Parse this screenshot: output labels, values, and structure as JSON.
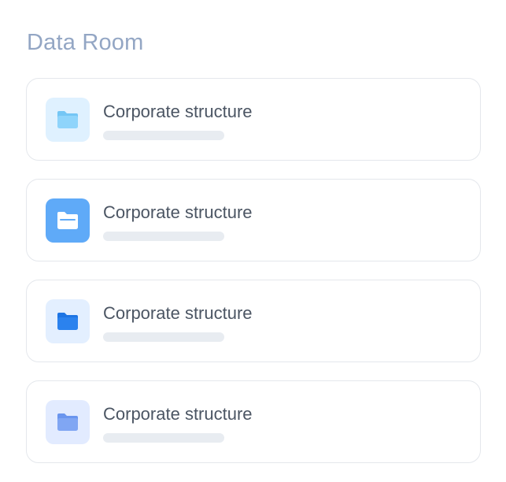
{
  "section": {
    "title": "Data Room"
  },
  "folders": [
    {
      "title": "Corporate structure",
      "icon": "folder-icon",
      "tile_color": "#dff1ff",
      "back_color": "#74c6f5",
      "front_color": "#8fd4fb",
      "detail_color": "#8fd4fb"
    },
    {
      "title": "Corporate structure",
      "icon": "folder-icon",
      "tile_color": "#5faaf8",
      "back_color": "#ffffff",
      "front_color": "#ffffff",
      "detail_color": "#5faaf8"
    },
    {
      "title": "Corporate structure",
      "icon": "folder-icon",
      "tile_color": "#e3efff",
      "back_color": "#1e75e4",
      "front_color": "#2b82ee",
      "detail_color": "#2b82ee"
    },
    {
      "title": "Corporate structure",
      "icon": "folder-icon",
      "tile_color": "#e2ebff",
      "back_color": "#6a95ee",
      "front_color": "#80a6f3",
      "detail_color": "#80a6f3"
    }
  ]
}
